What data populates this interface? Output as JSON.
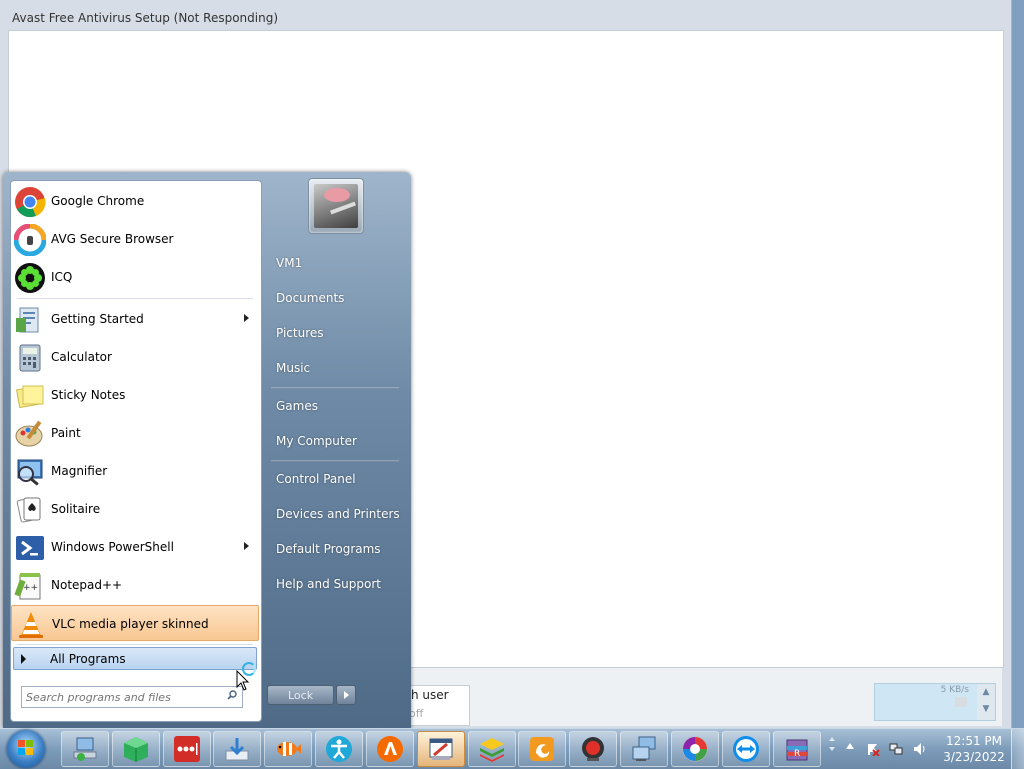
{
  "window": {
    "title": "Avast Free Antivirus Setup (Not Responding)",
    "notification_line1": "h user",
    "notification_line2": "off",
    "speed_text": "5 KB/s"
  },
  "start_menu": {
    "pinned": [
      {
        "label": "Google Chrome",
        "icon": "chrome-icon"
      },
      {
        "label": "AVG Secure Browser",
        "icon": "avg-browser-icon"
      },
      {
        "label": "ICQ",
        "icon": "icq-icon"
      }
    ],
    "recent": [
      {
        "label": "Getting Started",
        "icon": "getting-started-icon",
        "submenu": true
      },
      {
        "label": "Calculator",
        "icon": "calculator-icon",
        "submenu": false
      },
      {
        "label": "Sticky Notes",
        "icon": "sticky-notes-icon",
        "submenu": false
      },
      {
        "label": "Paint",
        "icon": "paint-icon",
        "submenu": false
      },
      {
        "label": "Magnifier",
        "icon": "magnifier-icon",
        "submenu": false
      },
      {
        "label": "Solitaire",
        "icon": "solitaire-icon",
        "submenu": false
      },
      {
        "label": "Windows PowerShell",
        "icon": "powershell-icon",
        "submenu": true
      },
      {
        "label": "Notepad++",
        "icon": "notepadpp-icon",
        "submenu": false
      },
      {
        "label": "VLC media player skinned",
        "icon": "vlc-icon",
        "submenu": false
      }
    ],
    "all_programs": "All Programs",
    "search_placeholder": "Search programs and files",
    "right_links": [
      "VM1",
      "Documents",
      "Pictures",
      "Music",
      "Games",
      "My Computer",
      "Control Panel",
      "Devices and Printers",
      "Default Programs",
      "Help and Support"
    ],
    "lock_label": "Lock"
  },
  "taskbar": {
    "time": "12:51 PM",
    "date": "3/23/2022"
  },
  "colors": {
    "taskbar": "#7d9cba",
    "highlight": "#f9c792",
    "accent": "#3b7fc4"
  }
}
